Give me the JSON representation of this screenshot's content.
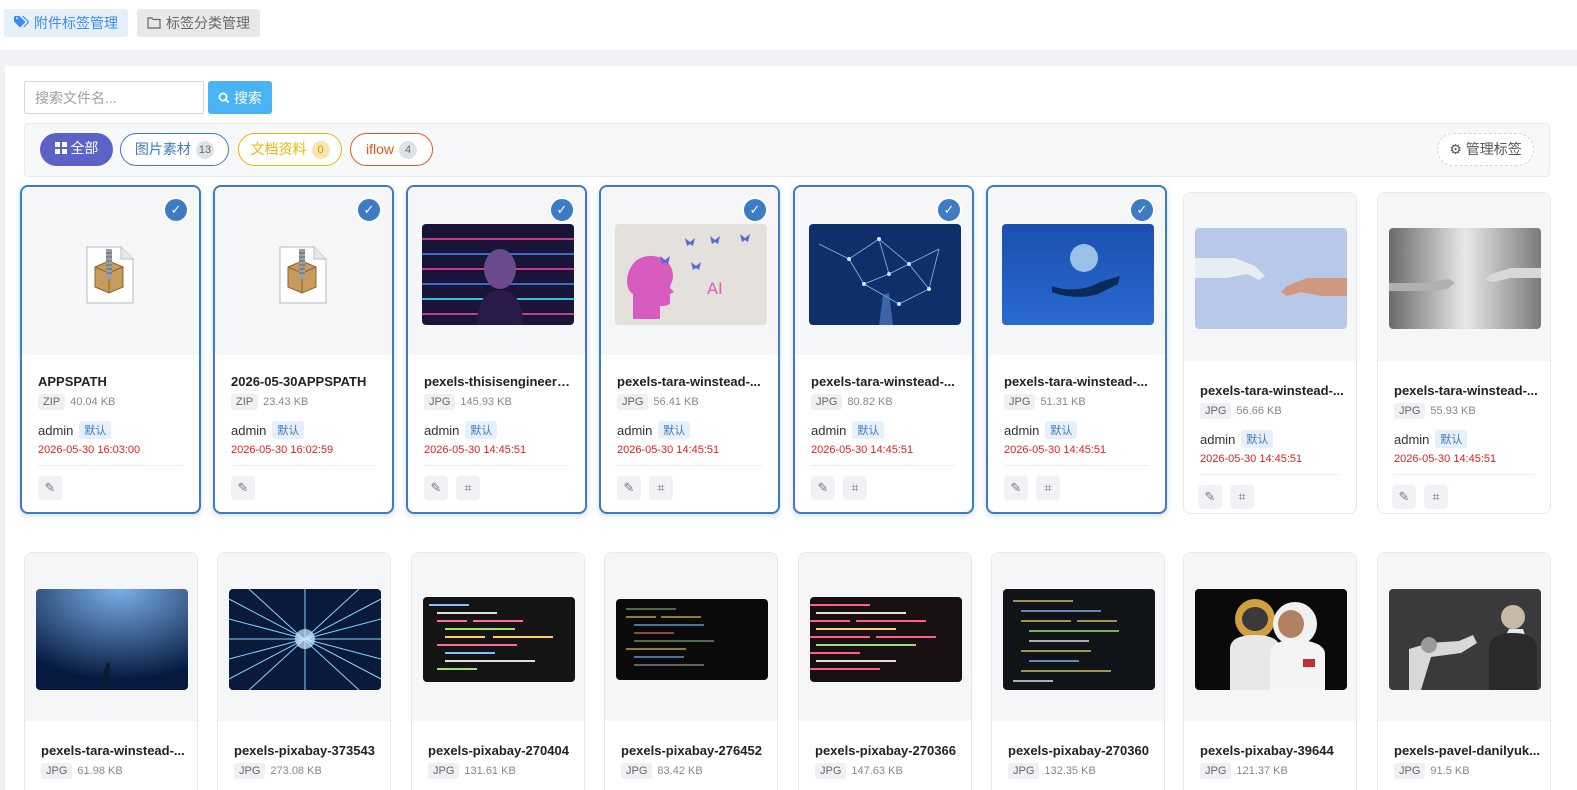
{
  "top_tabs": [
    {
      "label": "附件标签管理",
      "icon": "tags-icon",
      "active": true
    },
    {
      "label": "标签分类管理",
      "icon": "folder-icon",
      "active": false
    }
  ],
  "search": {
    "placeholder": "搜索文件名...",
    "button_label": "搜索"
  },
  "filters": [
    {
      "label": "全部",
      "icon": "grid-icon",
      "active": true,
      "color": "#5b62c8"
    },
    {
      "label": "图片素材",
      "count": "13",
      "color": "#3d7bc4"
    },
    {
      "label": "文档资料",
      "count": "0",
      "color": "#f0b400"
    },
    {
      "label": "iflow",
      "count": "4",
      "color": "#e8541e"
    }
  ],
  "manage_tags_label": "管理标签",
  "colors": {
    "selected_border": "#3d7bc4",
    "date": "#e02020",
    "search_button": "#4ab3f4",
    "all_pill": "#5b62c8"
  },
  "files": [
    {
      "name": "APPSPATH",
      "ext": "ZIP",
      "size": "40.04 KB",
      "owner": "admin",
      "tag": "默认",
      "date": "2026-05-30 16:03:00",
      "selected": true,
      "image": "zip-icon"
    },
    {
      "name": "2026-05-30APPSPATH",
      "ext": "ZIP",
      "size": "23.43 KB",
      "owner": "admin",
      "tag": "默认",
      "date": "2026-05-30 16:02:59",
      "selected": true,
      "image": "zip-icon"
    },
    {
      "name": "pexels-thisisengineeri...",
      "ext": "JPG",
      "size": "145.93 KB",
      "owner": "admin",
      "tag": "默认",
      "date": "2026-05-30 14:45:51",
      "selected": true,
      "image": "woman-code-projection"
    },
    {
      "name": "pexels-tara-winstead-...",
      "ext": "JPG",
      "size": "56.41 KB",
      "owner": "admin",
      "tag": "默认",
      "date": "2026-05-30 14:45:51",
      "selected": true,
      "image": "ai-head-butterflies"
    },
    {
      "name": "pexels-tara-winstead-...",
      "ext": "JPG",
      "size": "80.82 KB",
      "owner": "admin",
      "tag": "默认",
      "date": "2026-05-30 14:45:51",
      "selected": true,
      "image": "blue-network-hand"
    },
    {
      "name": "pexels-tara-winstead-...",
      "ext": "JPG",
      "size": "51.31 KB",
      "owner": "admin",
      "tag": "默认",
      "date": "2026-05-30 14:45:51",
      "selected": true,
      "image": "hand-holding-sphere"
    },
    {
      "name": "pexels-tara-winstead-...",
      "ext": "JPG",
      "size": "56.66 KB",
      "owner": "admin",
      "tag": "默认",
      "date": "2026-05-30 14:45:51",
      "selected": false,
      "image": "robot-human-hands-blue"
    },
    {
      "name": "pexels-tara-winstead-...",
      "ext": "JPG",
      "size": "55.93 KB",
      "owner": "admin",
      "tag": "默认",
      "date": "2026-05-30 14:45:51",
      "selected": false,
      "image": "robot-human-hands-gray"
    },
    {
      "name": "pexels-tara-winstead-...",
      "ext": "JPG",
      "size": "61.98 KB",
      "selected": false,
      "image": "underwater-hand"
    },
    {
      "name": "pexels-pixabay-373543",
      "ext": "JPG",
      "size": "273.08 KB",
      "selected": false,
      "image": "light-network"
    },
    {
      "name": "pexels-pixabay-270404",
      "ext": "JPG",
      "size": "131.61 KB",
      "selected": false,
      "image": "code-screen"
    },
    {
      "name": "pexels-pixabay-276452",
      "ext": "JPG",
      "size": "83.42 KB",
      "selected": false,
      "image": "code-screen-dark"
    },
    {
      "name": "pexels-pixabay-270366",
      "ext": "JPG",
      "size": "147.63 KB",
      "selected": false,
      "image": "code-screen-red"
    },
    {
      "name": "pexels-pixabay-270360",
      "ext": "JPG",
      "size": "132.35 KB",
      "selected": false,
      "image": "code-screen-yellow"
    },
    {
      "name": "pexels-pixabay-39644",
      "ext": "JPG",
      "size": "121.37 KB",
      "selected": false,
      "image": "astronauts"
    },
    {
      "name": "pexels-pavel-danilyuk...",
      "ext": "JPG",
      "size": "91.5 KB",
      "selected": false,
      "image": "man-robot-arm"
    }
  ]
}
